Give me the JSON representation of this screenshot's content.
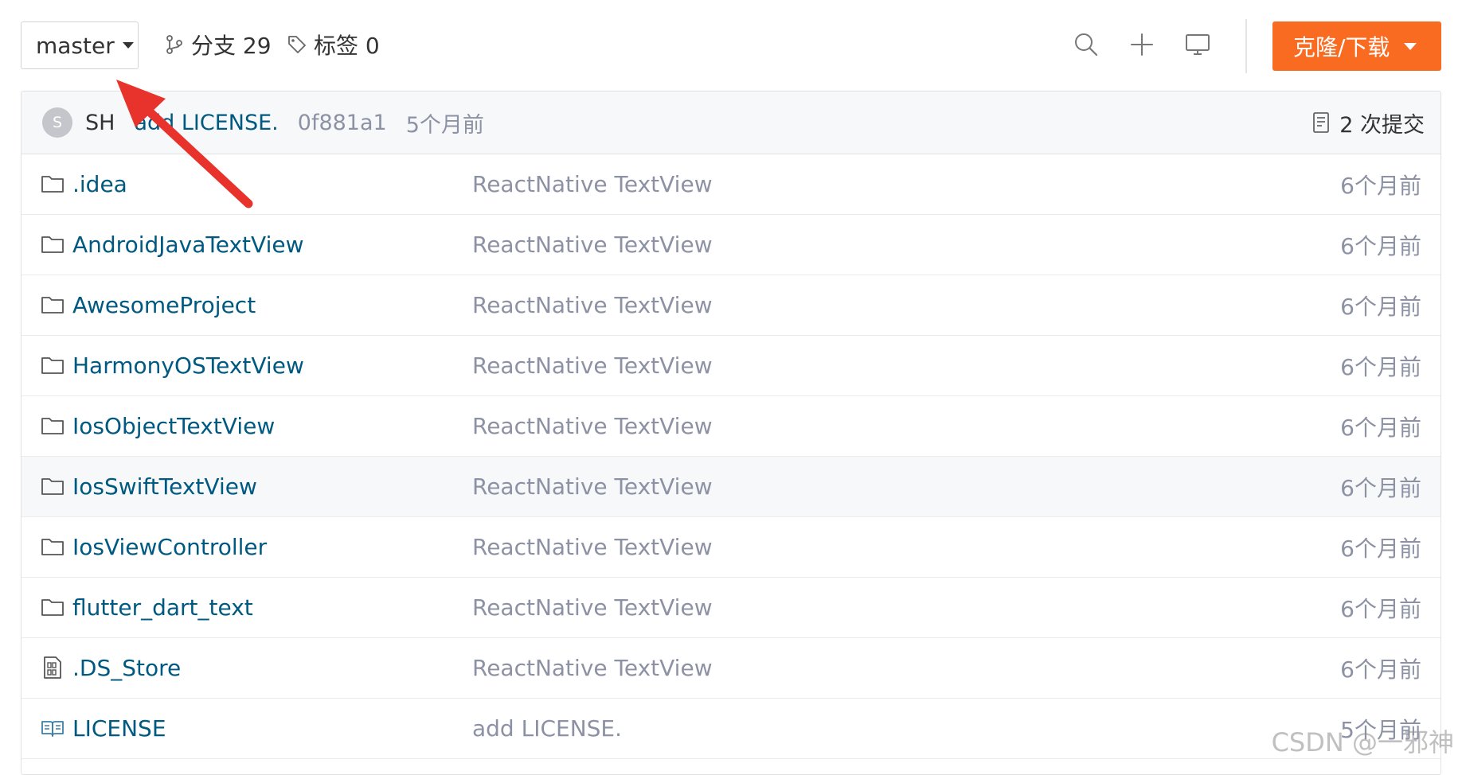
{
  "toolbar": {
    "branch": "master",
    "branches_label": "分支 29",
    "tags_label": "标签 0",
    "clone_label": "克隆/下载"
  },
  "commit_bar": {
    "avatar_letter": "S",
    "author": "SH",
    "message": "add LICENSE.",
    "sha": "0f881a1",
    "time": "5个月前",
    "count": "2 次提交"
  },
  "files": [
    {
      "name": ".idea",
      "type": "folder",
      "commit": "ReactNative TextView",
      "time": "6个月前"
    },
    {
      "name": "AndroidJavaTextView",
      "type": "folder",
      "commit": "ReactNative TextView",
      "time": "6个月前"
    },
    {
      "name": "AwesomeProject",
      "type": "folder",
      "commit": "ReactNative TextView",
      "time": "6个月前"
    },
    {
      "name": "HarmonyOSTextView",
      "type": "folder",
      "commit": "ReactNative TextView",
      "time": "6个月前"
    },
    {
      "name": "IosObjectTextView",
      "type": "folder",
      "commit": "ReactNative TextView",
      "time": "6个月前"
    },
    {
      "name": "IosSwiftTextView",
      "type": "folder",
      "commit": "ReactNative TextView",
      "time": "6个月前"
    },
    {
      "name": "IosViewController",
      "type": "folder",
      "commit": "ReactNative TextView",
      "time": "6个月前"
    },
    {
      "name": "flutter_dart_text",
      "type": "folder",
      "commit": "ReactNative TextView",
      "time": "6个月前"
    },
    {
      "name": ".DS_Store",
      "type": "binary-file",
      "commit": "ReactNative TextView",
      "time": "6个月前"
    },
    {
      "name": "LICENSE",
      "type": "license-file",
      "commit": "add LICENSE.",
      "time": "5个月前"
    }
  ],
  "watermark": "CSDN @一邪神",
  "colors": {
    "accent": "#fa6b22",
    "link": "#005980",
    "muted": "#8c92a4",
    "arrow": "#e8332c"
  }
}
